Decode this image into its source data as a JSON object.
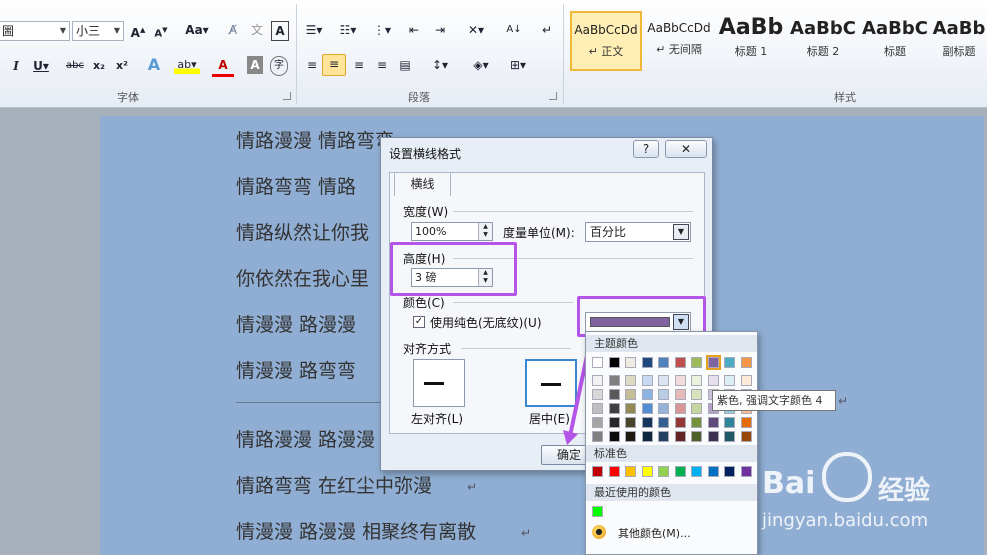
{
  "ribbon": {
    "font_group_label": "字体",
    "paragraph_group_label": "段落",
    "styles_group_label": "样式",
    "font_name": "圌",
    "font_size": "小三",
    "styles": [
      {
        "sample": "AaBbCcDd",
        "name": "↵ 正文"
      },
      {
        "sample": "AaBbCcDd",
        "name": "↵ 无间隔"
      },
      {
        "sample": "AaBb",
        "name": "标题 1"
      },
      {
        "sample": "AaBbC",
        "name": "标题 2"
      },
      {
        "sample": "AaBbC",
        "name": "标题"
      },
      {
        "sample": "AaBb",
        "name": "副标题"
      }
    ]
  },
  "document": {
    "lines": [
      "情路漫漫 情路弯弯",
      "情路弯弯 情路",
      "情路纵然让你我",
      "你依然在我心里",
      "情漫漫 路漫漫",
      "情漫漫 路弯弯",
      "情路漫漫 路漫漫",
      "情路弯弯 在红尘中弥漫",
      "情漫漫 路漫漫 相聚终有离散"
    ],
    "para_mark": "↵"
  },
  "dialog": {
    "title": "设置横线格式",
    "help_button": "?",
    "close_button": "✕",
    "tab_label": "横线",
    "width_label": "宽度(W)",
    "width_value": "100%",
    "unit_label": "度量单位(M):",
    "unit_value": "百分比",
    "height_label": "高度(H)",
    "height_value": "3 磅",
    "color_label": "颜色(C)",
    "solid_color_label": "使用纯色(无底纹)(U)",
    "solid_color_checked": "✓",
    "selected_color": "#8064a2",
    "align_label": "对齐方式",
    "align_left_label": "左对齐(L)",
    "align_center_label": "居中(E)",
    "ok_button": "确定"
  },
  "palette": {
    "theme_header": "主题颜色",
    "standard_header": "标准色",
    "recent_header": "最近使用的颜色",
    "more_colors": "其他颜色(M)...",
    "theme_top": [
      "#ffffff",
      "#000000",
      "#eeece1",
      "#1f497d",
      "#4f81bd",
      "#c0504d",
      "#9bbb59",
      "#8064a2",
      "#4bacc6",
      "#f79646"
    ],
    "theme_shades": [
      [
        "#f2f2f2",
        "#7f7f7f",
        "#ddd9c3",
        "#c6d9f0",
        "#dbe5f1",
        "#f2dcdb",
        "#ebf1dd",
        "#e5e0ec",
        "#dbeef3",
        "#fdeada"
      ],
      [
        "#d8d8d8",
        "#595959",
        "#c4bd97",
        "#8db3e2",
        "#b8cce4",
        "#e5b9b7",
        "#d7e3bc",
        "#ccc1d9",
        "#b7dde8",
        "#fbd5b5"
      ],
      [
        "#bfbfbf",
        "#3f3f3f",
        "#938953",
        "#548dd4",
        "#95b3d7",
        "#d99694",
        "#c3d69b",
        "#b2a2c7",
        "#92cddc",
        "#fac08f"
      ],
      [
        "#a5a5a5",
        "#262626",
        "#494429",
        "#17365d",
        "#366092",
        "#953734",
        "#76923c",
        "#5f497a",
        "#31859b",
        "#e36c09"
      ],
      [
        "#7f7f7f",
        "#0c0c0c",
        "#1d1b10",
        "#0f243e",
        "#244061",
        "#632423",
        "#4f6128",
        "#3f3151",
        "#205867",
        "#974806"
      ]
    ],
    "standard": [
      "#c00000",
      "#ff0000",
      "#ffc000",
      "#ffff00",
      "#92d050",
      "#00b050",
      "#00b0f0",
      "#0070c0",
      "#002060",
      "#7030a0"
    ],
    "recent": [
      "#00ff00"
    ]
  },
  "tooltip": "紫色, 强调文字颜色 4",
  "watermark": {
    "brand": "Bai",
    "brand_cn": "经验",
    "url": "jingyan.baidu.com"
  }
}
